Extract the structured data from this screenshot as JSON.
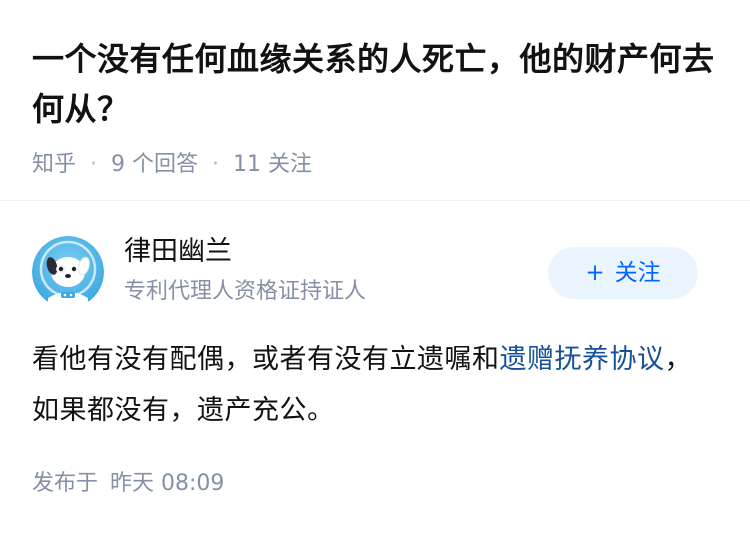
{
  "question": {
    "title": "一个没有任何血缘关系的人死亡，他的财产何去何从？",
    "source": "知乎",
    "separator": "·",
    "answers_count": "9 个回答",
    "followers_count": "11 关注"
  },
  "answer": {
    "author": {
      "name": "律田幽兰",
      "headline": "专利代理人资格证持证人",
      "avatar_icon": "cartoon-dog-avatar"
    },
    "follow_button": {
      "icon": "plus-icon",
      "icon_glyph": "+",
      "label": "关注"
    },
    "content": {
      "text_before_link": "看他有没有配偶，或者有没有立遗嘱和",
      "link_text": "遗赠抚养协议",
      "text_after_link": "，如果都没有，遗产充公。"
    },
    "publish": {
      "prefix": "发布于",
      "date": "昨天 08:09"
    }
  },
  "colors": {
    "text_primary": "#121212",
    "text_secondary": "#8590a6",
    "link": "#175199",
    "follow_bg": "#ebf5ff",
    "follow_text": "#0066ff"
  }
}
